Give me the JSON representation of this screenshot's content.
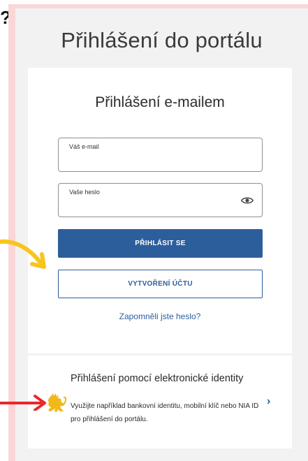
{
  "annotation": {
    "question_mark": "?"
  },
  "portal": {
    "title": "Přihlášení do portálu"
  },
  "email_login": {
    "title": "Přihlášení e-mailem",
    "email_label": "Váš e-mail",
    "email_value": "",
    "password_label": "Vaše heslo",
    "password_value": "",
    "login_button": "PŘIHLÁSIT SE",
    "create_account_button": "VYTVOŘENÍ ÚČTU",
    "forgot_link": "Zapomněli jste heslo?"
  },
  "identity_login": {
    "title": "Přihlášení pomocí elektronické identity",
    "description": "Využijte například bankovní identitu, mobilní klíč nebo NIA ID pro přihlášení do portálu."
  },
  "colors": {
    "accent": "#2d5e9c",
    "frame": "#fbd6d6",
    "panel": "#f2f2f2",
    "arrow_yellow": "#f7c51e",
    "arrow_red": "#e8282b",
    "lion": "#f0b81a"
  },
  "icons": {
    "password_toggle": "eye-icon",
    "identity_logo": "czech-lion-icon",
    "identity_chevron": "chevron-right-icon"
  }
}
